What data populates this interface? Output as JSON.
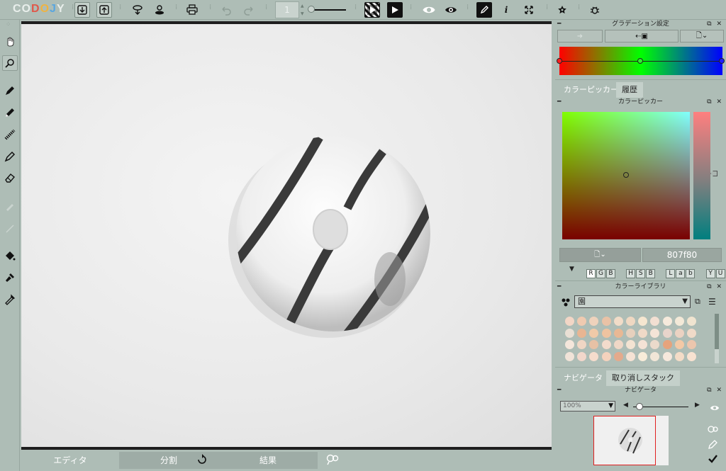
{
  "app": {
    "logo_text": "CODOJY"
  },
  "toolbar": {
    "frame_value": "1",
    "buttons": [
      "import-icon",
      "export-icon",
      "merge-icon",
      "stamp-icon",
      "print-icon",
      "undo-icon",
      "redo-icon",
      "checker-play-icon",
      "play-icon",
      "eye-icon",
      "onion-skin-icon",
      "pen-mode-icon",
      "info-icon",
      "fullscreen-icon",
      "settings-star-icon",
      "bug-icon"
    ]
  },
  "tools": [
    "hand-icon",
    "zoom-icon",
    "pen-icon",
    "pencil-icon",
    "airbrush-icon",
    "marker-icon",
    "eraser-icon",
    "brush-disabled-icon",
    "line-disabled-icon",
    "fill-icon",
    "dropper-fill-icon",
    "eyedropper-icon"
  ],
  "bottom_tabs": {
    "editor": "エディタ",
    "split": "分割",
    "result": "結果"
  },
  "gradient_panel": {
    "title": "グラデーション設定",
    "colors": {
      "start": "#ff0000",
      "mid": "#00ff00",
      "end": "#0000ff"
    }
  },
  "picker_tabs": {
    "color_picker": "カラーピッカー",
    "history": "履歴"
  },
  "color_picker": {
    "title": "カラーピッカー",
    "hex_value": "807f80",
    "modes": {
      "selected": [
        "R",
        "G",
        "B"
      ],
      "hsb": [
        "H",
        "S",
        "B"
      ],
      "lab": [
        "L",
        "a",
        "b"
      ],
      "yuv": [
        "Y",
        "U",
        "V"
      ]
    }
  },
  "library": {
    "title": "カラーライブラリ",
    "selected_set": "園",
    "swatches": [
      "#f2d6c6",
      "#efcab0",
      "#eed2bc",
      "#e9c2a6",
      "#f1dcc8",
      "#efd8c2",
      "#f5e6d0",
      "#f2dfd2",
      "#f6eadc",
      "#f3e9d8",
      "#f0e4d0",
      "#e9dfd4",
      "#e8b592",
      "#f1caa8",
      "#efc3a0",
      "#e8b894",
      "#e6d0bd",
      "#efd9c7",
      "#f5e4d7",
      "#e8d4cb",
      "#ebd2c2",
      "#f0dac8",
      "#f4e6db",
      "#f0d6c4",
      "#e7c1a5",
      "#f3dbcc",
      "#efd7c6",
      "#f3e3d2",
      "#f4e2d5",
      "#ebdacb",
      "#e6a37c",
      "#f3c9a6",
      "#ecc6ad",
      "#f1e3d8",
      "#f2d7cb",
      "#f5dccc",
      "#f4d2bd",
      "#e4aa8c",
      "#f5e2d4",
      "#f8ecd9",
      "#f2e6d7",
      "#f6e8dc",
      "#f4dcc7",
      "#f8e2d1"
    ]
  },
  "nav_tabs": {
    "navigator": "ナビゲータ",
    "undo_stack": "取り消しスタック"
  },
  "navigator": {
    "title": "ナビゲータ",
    "zoom": "100%",
    "zoom_level": 0.05
  }
}
